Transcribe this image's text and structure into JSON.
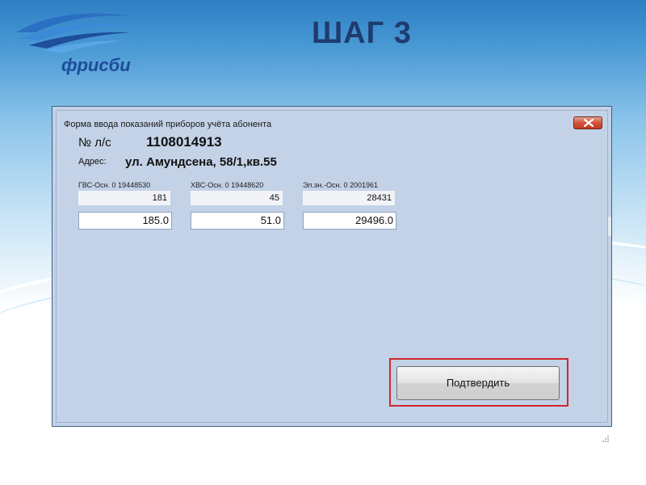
{
  "slide": {
    "logo_text": "фрисби",
    "title": "ШАГ 3"
  },
  "window": {
    "title": "Форма ввода показаний приборов учёта абонента"
  },
  "account": {
    "label": "№ л/с",
    "value": "1108014913"
  },
  "address": {
    "label": "Адрес:",
    "value": "ул. Амундсена, 58/1,кв.55"
  },
  "meters": [
    {
      "label": "ГВС-Осн. 0 19448530",
      "previous": "181",
      "current": "185.0"
    },
    {
      "label": "ХВС-Осн. 0 19448620",
      "previous": "45",
      "current": "51.0"
    },
    {
      "label": "Эл.эн.-Осн. 0 2001961",
      "previous": "28431",
      "current": "29496.0"
    }
  ],
  "confirm_button": {
    "label": "Подтвердить"
  },
  "colors": {
    "highlight": "#d0262e",
    "close_button": "#c03b22",
    "window_bg": "#c3d2e6"
  }
}
